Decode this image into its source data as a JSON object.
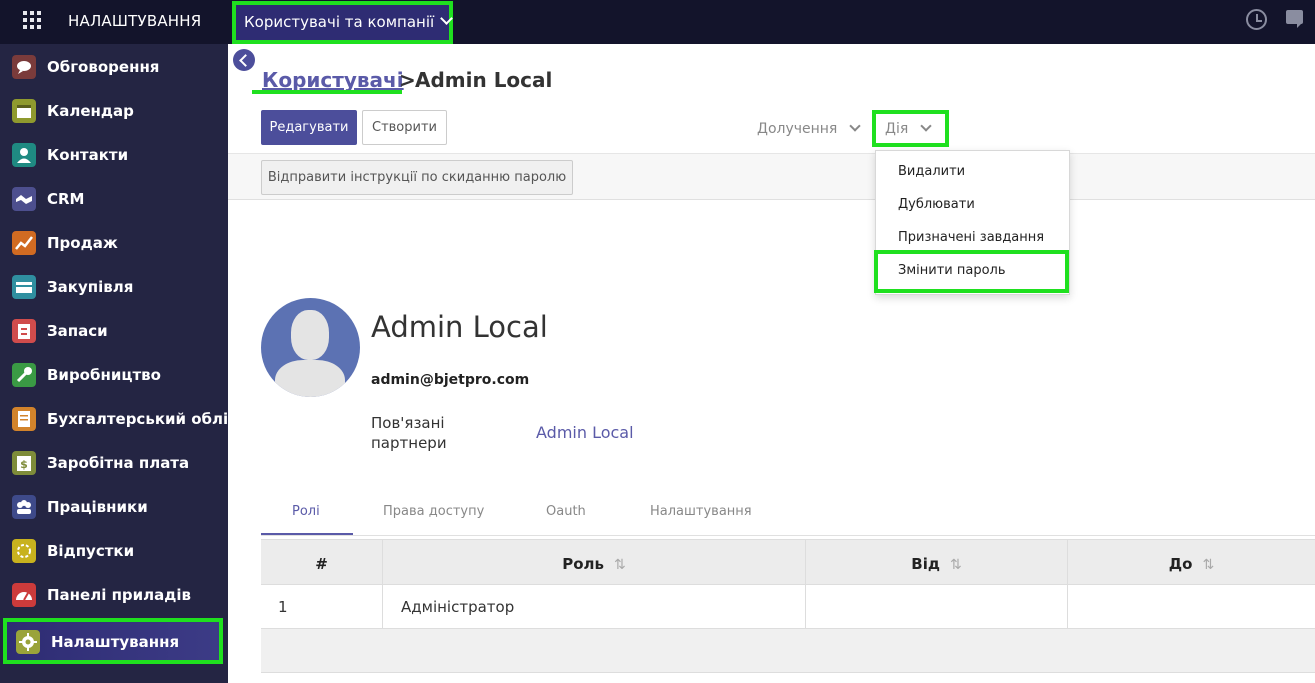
{
  "topbar": {
    "app_title": "НАЛАШТУВАННЯ",
    "menu_label": "Користувачі та компанії"
  },
  "sidebar": {
    "items": [
      {
        "label": "Обговорення",
        "icon": "discuss-icon",
        "color": "#7a3b3b"
      },
      {
        "label": "Календар",
        "icon": "calendar-icon",
        "color": "#8f9a2e"
      },
      {
        "label": "Контакти",
        "icon": "contacts-icon",
        "color": "#1f8a82"
      },
      {
        "label": "CRM",
        "icon": "crm-handshake-icon",
        "color": "#4d4f8e"
      },
      {
        "label": "Продаж",
        "icon": "sales-chart-icon",
        "color": "#d16b22"
      },
      {
        "label": "Закупівля",
        "icon": "purchase-card-icon",
        "color": "#2f8fa0"
      },
      {
        "label": "Запаси",
        "icon": "inventory-icon",
        "color": "#d04c4c"
      },
      {
        "label": "Виробництво",
        "icon": "manufacturing-wrench-icon",
        "color": "#3a9a44"
      },
      {
        "label": "Бухгалтерський облік",
        "icon": "accounting-icon",
        "color": "#d2832b"
      },
      {
        "label": "Заробітна плата",
        "icon": "payroll-icon",
        "color": "#7e8c3a"
      },
      {
        "label": "Працівники",
        "icon": "employees-icon",
        "color": "#3e4a8a"
      },
      {
        "label": "Відпустки",
        "icon": "leaves-icon",
        "color": "#c8b21e"
      },
      {
        "label": "Панелі приладів",
        "icon": "dashboards-icon",
        "color": "#cc3b3b"
      },
      {
        "label": "Налаштування",
        "icon": "settings-gear-icon",
        "color": "#9aa33a"
      }
    ]
  },
  "breadcrumb": {
    "parent": "Користувачі",
    "separator": ">",
    "current": "Admin Local"
  },
  "toolbar": {
    "edit_label": "Редагувати",
    "create_label": "Створити",
    "attachments_label": "Долучення",
    "action_label": "Дія"
  },
  "statusbar": {
    "reset_password_label": "Відправити інструкції по скиданню паролю"
  },
  "action_menu": {
    "items": [
      "Видалити",
      "Дублювати",
      "Призначені завдання",
      "Змінити пароль"
    ]
  },
  "user": {
    "name": "Admin Local",
    "email": "admin@bjetpro.com",
    "partners_label": "Пов'язані партнери",
    "partners_value": "Admin Local"
  },
  "tabs": [
    "Ролі",
    "Права доступу",
    "Oauth",
    "Налаштування"
  ],
  "table": {
    "columns": [
      "#",
      "Роль",
      "Від",
      "До"
    ],
    "sort_icon": "⇅",
    "rows": [
      [
        "1",
        "Адміністратор",
        "",
        ""
      ]
    ]
  },
  "colors": {
    "topbar_bg": "#13142b",
    "sidebar_bg": "#242543",
    "accent": "#4c4e9b",
    "highlight": "#1fe01f"
  }
}
